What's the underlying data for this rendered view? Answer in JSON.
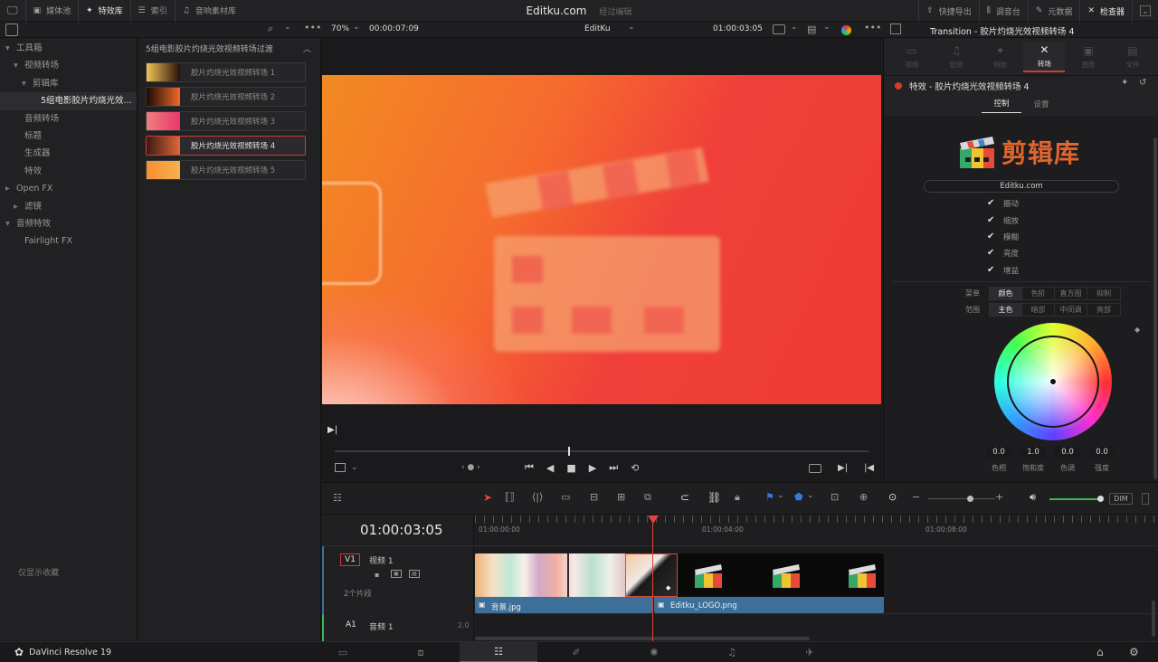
{
  "topbar": {
    "media_pool": "媒体池",
    "effects": "特效库",
    "index": "索引",
    "sound_library": "音响素材库",
    "app_title": "Editku.com",
    "subtitle": "经过编辑",
    "quick_export": "快捷导出",
    "mixer": "调音台",
    "metadata": "元数据",
    "inspector": "检查器"
  },
  "viewer_bar": {
    "zoom": "70%",
    "source_timecode": "00:00:07:09",
    "project_name": "EditKu",
    "current_timecode": "01:00:03:05"
  },
  "inspector_header": {
    "title": "Transition - 胶片灼烧光效视频转场 4"
  },
  "left_panel": {
    "items": [
      {
        "label": "工具箱",
        "indent": 0,
        "arrow": "▾"
      },
      {
        "label": "视频转场",
        "indent": 1,
        "arrow": "▾"
      },
      {
        "label": "剪辑库",
        "indent": 2,
        "arrow": "▾"
      },
      {
        "label": "5组电影胶片灼烧光效...",
        "indent": 3,
        "arrow": ""
      },
      {
        "label": "音频转场",
        "indent": 1,
        "arrow": ""
      },
      {
        "label": "标题",
        "indent": 1,
        "arrow": ""
      },
      {
        "label": "生成器",
        "indent": 1,
        "arrow": ""
      },
      {
        "label": "特效",
        "indent": 1,
        "arrow": ""
      },
      {
        "label": "Open FX",
        "indent": 0,
        "arrow": "▸"
      },
      {
        "label": "滤镜",
        "indent": 1,
        "arrow": "▸"
      },
      {
        "label": "音频特效",
        "indent": 0,
        "arrow": "▾"
      },
      {
        "label": "Fairlight FX",
        "indent": 1,
        "arrow": ""
      }
    ],
    "favorites_only": "仅显示收藏"
  },
  "clip_panel": {
    "header": "5组电影胶片灼烧光效视频转场过渡",
    "clips": [
      {
        "label": "胶片灼烧光效视频转场 1",
        "c1": "#f2c35a",
        "c2": "#2a1208"
      },
      {
        "label": "胶片灼烧光效视频转场 2",
        "c1": "#1a0a05",
        "c2": "#f26a2a"
      },
      {
        "label": "胶片灼烧光效视频转场 3",
        "c1": "#f07f7f",
        "c2": "#e8386a"
      },
      {
        "label": "胶片灼烧光效视频转场 4",
        "c1": "#3a1a10",
        "c2": "#e0683a"
      },
      {
        "label": "胶片灼烧光效视频转场 5",
        "c1": "#f59030",
        "c2": "#f6b050"
      }
    ]
  },
  "inspector": {
    "tabs": [
      "视频",
      "音频",
      "特效",
      "转场",
      "图像",
      "文件"
    ],
    "active_tab": "转场",
    "effect_title": "特效 - 胶片灼烧光效视频转场 4",
    "subtabs": [
      "控制",
      "设置"
    ],
    "logo_text": "剪辑库",
    "site_button": "Editku.com",
    "checks": [
      "振动",
      "缩放",
      "模糊",
      "亮度",
      "增益"
    ],
    "menu_label": "菜单",
    "menu_options": [
      "颜色",
      "色阶",
      "直方图",
      "抑制"
    ],
    "range_label": "范围",
    "range_options": [
      "主色",
      "暗部",
      "中间调",
      "亮部"
    ],
    "values": [
      {
        "value": "0.0",
        "label": "色相"
      },
      {
        "value": "1.0",
        "label": "饱和度"
      },
      {
        "value": "0.0",
        "label": "色调"
      },
      {
        "value": "0.0",
        "label": "强度"
      }
    ]
  },
  "timeline": {
    "timecode": "01:00:03:05",
    "ruler": [
      "01:00:00:00",
      "01:00:04:00",
      "01:00:08:00"
    ],
    "video_track": {
      "id": "V1",
      "name": "视频 1",
      "clip_count": "2个片段"
    },
    "audio_track": {
      "id": "A1",
      "name": "音频 1",
      "channels": "2.0"
    },
    "clips": [
      {
        "name": "背景.jpg"
      },
      {
        "name": "Editku_LOGO.png"
      }
    ],
    "dim_label": "DIM"
  },
  "bottombar": {
    "app_name": "DaVinci Resolve 19"
  },
  "colors": {
    "accent_red": "#d23c2c",
    "clip_blue": "#3d6f98",
    "transition_red": "#d94a3a",
    "audio_green": "#3fb454"
  }
}
